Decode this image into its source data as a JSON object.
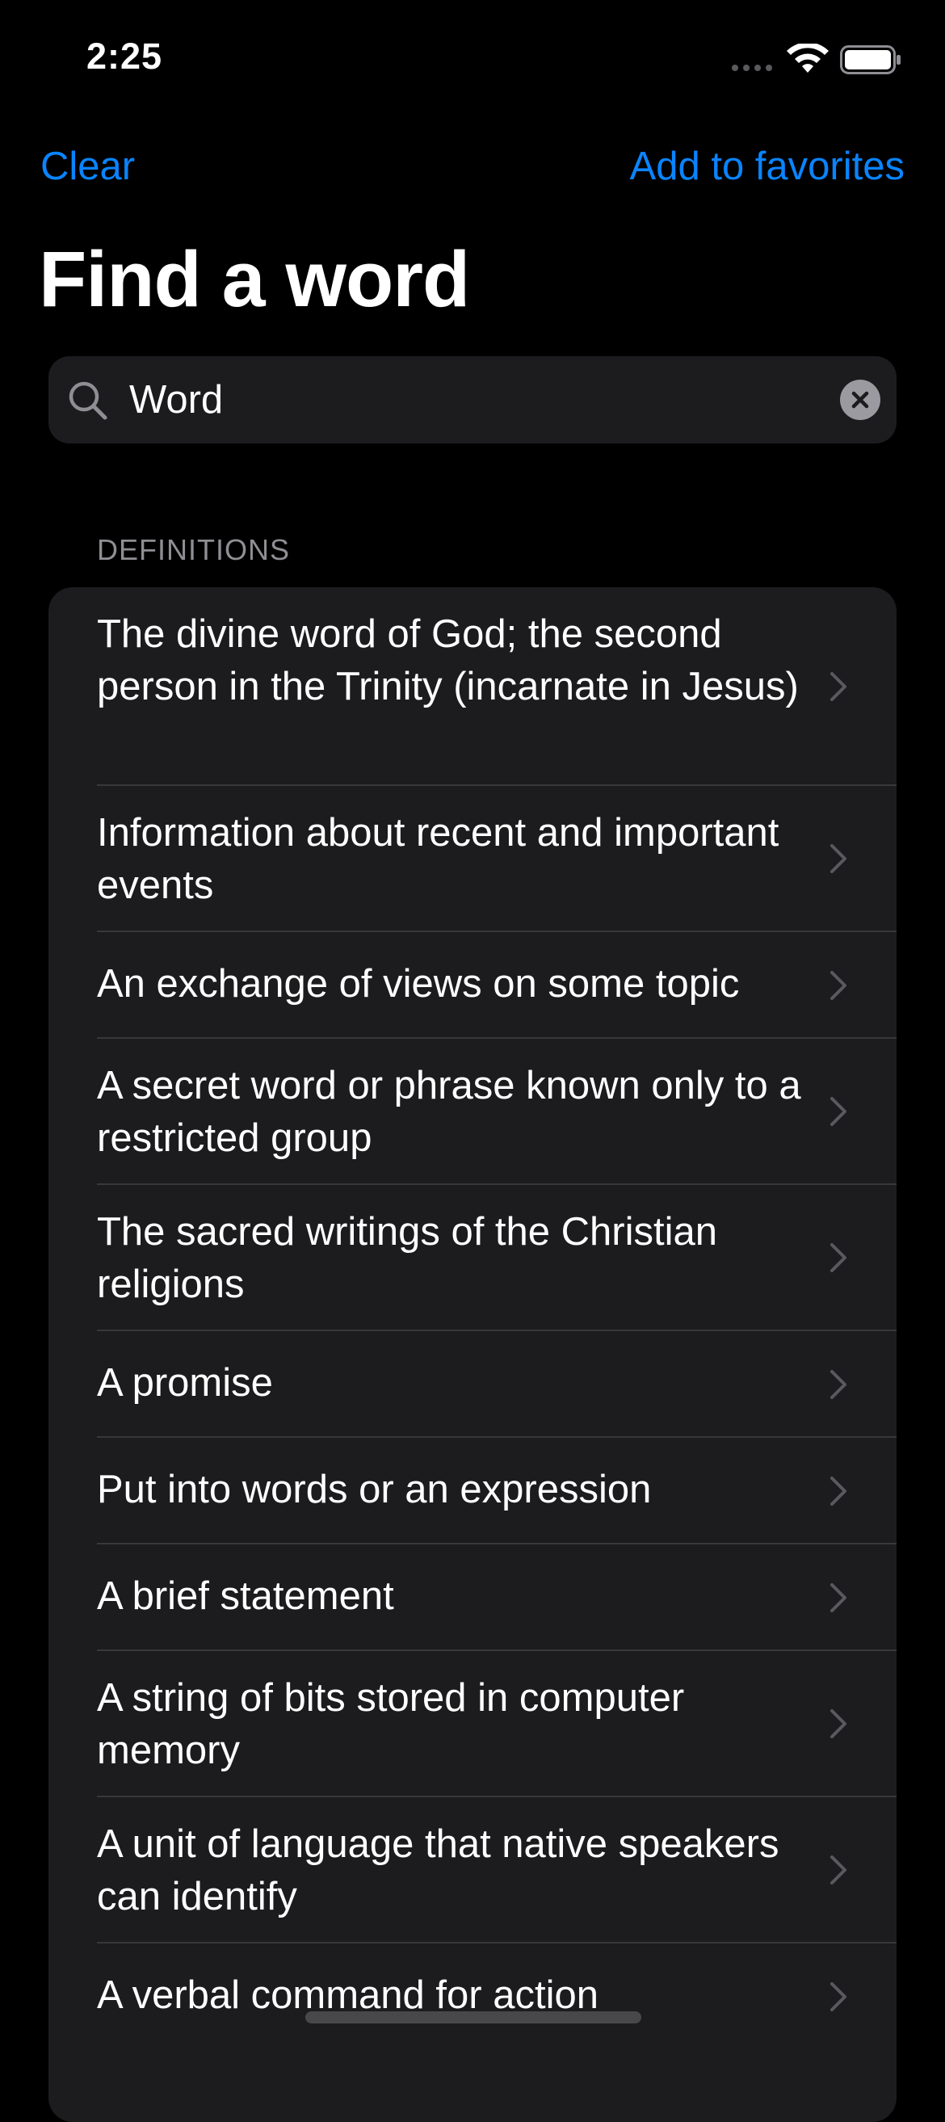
{
  "status_bar": {
    "time": "2:25",
    "wifi_icon": "wifi-icon",
    "battery_icon": "battery-icon",
    "battery_level": 1.0
  },
  "nav": {
    "clear_label": "Clear",
    "favorites_label": "Add to favorites"
  },
  "title": "Find a word",
  "search": {
    "value": "Word",
    "search_icon": "search-icon",
    "clear_icon": "clear-search-icon"
  },
  "section_header": "DEFINITIONS",
  "definitions": [
    "The divine word of God; the second person in the Trinity (incarnate in Jesus)",
    "Information about recent and important events",
    "An exchange of views on some topic",
    "A secret word or phrase known only to a restricted group",
    "The sacred writings of the Christian religions",
    "A promise",
    "Put into words or an expression",
    "A brief statement",
    "A string of bits stored in computer memory",
    "A unit of language that native speakers can identify",
    "A verbal command for action"
  ],
  "colors": {
    "accent": "#0a84ff",
    "background": "#000000",
    "cell": "#1c1c1e",
    "secondary_text": "#8e8e93"
  }
}
